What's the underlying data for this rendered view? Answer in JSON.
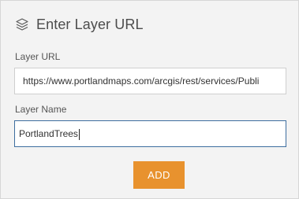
{
  "dialog": {
    "title": "Enter Layer URL",
    "icon": "layers-icon"
  },
  "layer_url": {
    "label": "Layer URL",
    "value": "https://www.portlandmaps.com/arcgis/rest/services/Publi"
  },
  "layer_name": {
    "label": "Layer Name",
    "value": "PortlandTrees"
  },
  "actions": {
    "add_label": "ADD"
  },
  "colors": {
    "panel_background": "#f3f3f3",
    "accent": "#e8922e",
    "focus_border": "#3e6e9f"
  }
}
